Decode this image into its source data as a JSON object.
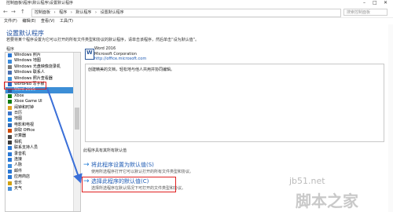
{
  "window": {
    "title": "控制面板\\程序\\默认程序\\设置默认程序",
    "controls": [
      "–",
      "□",
      "✕"
    ]
  },
  "address": {
    "nav": [
      "←",
      "→",
      "↑"
    ],
    "segments": [
      "控制面板",
      "程序",
      "默认程序",
      "设置默认程序"
    ],
    "search_placeholder": "搜索控制面板"
  },
  "menu": [
    "文件(F)",
    "编辑(E)",
    "查看(V)",
    "工具(T)"
  ],
  "page": {
    "heading": "设置默认程序",
    "description": "若要将某个程序设置为它可以打开的所有文件类型和协议的默认程序，请单击该程序，然后单击“设为默认值”。",
    "list_label": "程序"
  },
  "programs": [
    {
      "label": "Windows 照片",
      "color": "#2b78d4"
    },
    {
      "label": "Windows 地图",
      "color": "#3a8bdc"
    },
    {
      "label": "Windows 光盘映像烧录机",
      "color": "#7a7a7a"
    },
    {
      "label": "Windows 联系人",
      "color": "#4a6fb0"
    },
    {
      "label": "Windows 照片查看器",
      "color": "#3a90d6"
    },
    {
      "label": "WordPad 写字板",
      "color": "#2b6cc4"
    },
    {
      "label": "Word 2016",
      "color": "#2b579a"
    },
    {
      "label": "Xbox",
      "color": "#107c10"
    },
    {
      "label": "Xbox Game UI",
      "color": "#107c10"
    },
    {
      "label": "闹钟和时钟",
      "color": "#e0a020"
    },
    {
      "label": "日历",
      "color": "#3b73c7"
    },
    {
      "label": "地图",
      "color": "#1e88e5"
    },
    {
      "label": "电影和电视",
      "color": "#2a6ab8"
    },
    {
      "label": "获取 Office",
      "color": "#d04a02"
    },
    {
      "label": "计算器",
      "color": "#4a4a4a"
    },
    {
      "label": "相机",
      "color": "#3a3a3a"
    },
    {
      "label": "联系支持人员",
      "color": "#2b78d4"
    },
    {
      "label": "录音机",
      "color": "#2b78d4"
    },
    {
      "label": "连接",
      "color": "#2b78d4"
    },
    {
      "label": "人脉",
      "color": "#3a8bdc"
    },
    {
      "label": "邮件",
      "color": "#2b78d4"
    },
    {
      "label": "应用商店",
      "color": "#2b78d4"
    },
    {
      "label": "音乐",
      "color": "#d0a010"
    },
    {
      "label": "天气",
      "color": "#4a90d9"
    }
  ],
  "selected_index": 6,
  "app": {
    "name": "Word 2016",
    "company": "Microsoft Corporation",
    "url": "http://office.microsoft.com",
    "description": "创建精美的文档，轻松地与他人共用并协同编辑。"
  },
  "defaults_status": "此程序具有其所有默认值",
  "options": [
    {
      "arrow": "→",
      "title": "将此程序设置为默认值(S)",
      "subtitle": "使用所选程序打开它可以默认打开的所有文件类型和协议。"
    },
    {
      "arrow": "→",
      "title": "选择此程序的默认值(C)",
      "subtitle": "选择所选程序在默认情况下可打开的文件类型和协议。"
    }
  ],
  "watermark": {
    "line1": "jb51.net",
    "line2": "脚本之家"
  }
}
